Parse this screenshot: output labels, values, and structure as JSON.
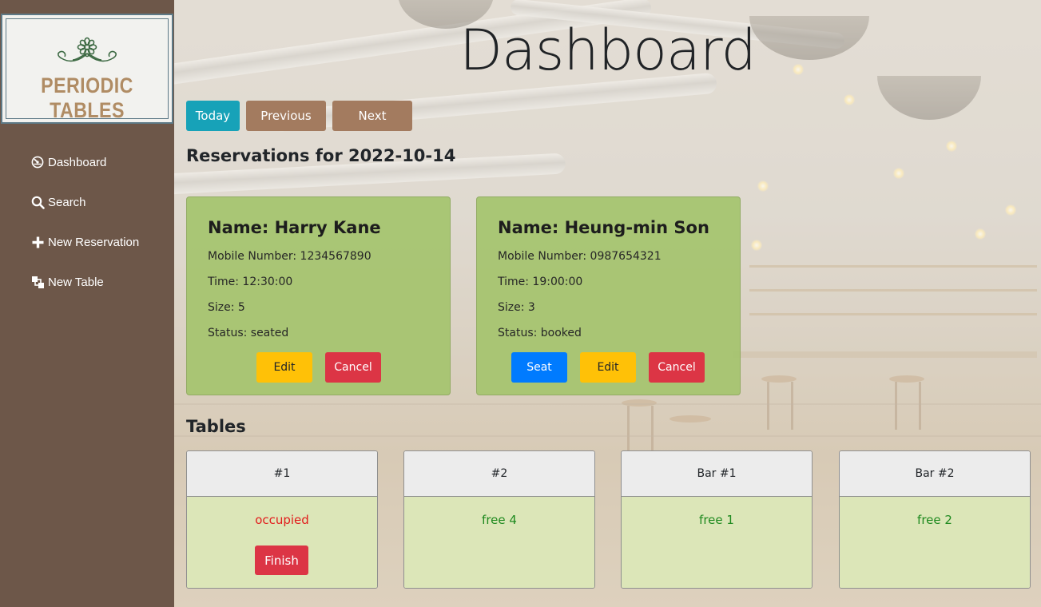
{
  "app": {
    "name": "PERIODIC TABLES"
  },
  "sidebar": {
    "items": [
      {
        "label": "Dashboard",
        "icon": "dashboard-icon"
      },
      {
        "label": "Search",
        "icon": "search-icon"
      },
      {
        "label": "New Reservation",
        "icon": "plus-icon"
      },
      {
        "label": "New Table",
        "icon": "table-icon"
      }
    ]
  },
  "header": {
    "title": "Dashboard"
  },
  "date_nav": {
    "today_label": "Today",
    "previous_label": "Previous",
    "next_label": "Next"
  },
  "reservations": {
    "heading": "Reservations for 2022-10-14",
    "cards": [
      {
        "name": "Name: Harry Kane",
        "mobile": "Mobile Number: 1234567890",
        "time": "Time: 12:30:00",
        "size": "Size: 5",
        "status": "Status: seated",
        "buttons": {
          "edit": "Edit",
          "cancel": "Cancel"
        }
      },
      {
        "name": "Name: Heung-min Son",
        "mobile": "Mobile Number: 0987654321",
        "time": "Time: 19:00:00",
        "size": "Size: 3",
        "status": "Status: booked",
        "buttons": {
          "seat": "Seat",
          "edit": "Edit",
          "cancel": "Cancel"
        }
      }
    ]
  },
  "tables": {
    "heading": "Tables",
    "cards": [
      {
        "name": "#1",
        "status": "occupied",
        "finish_label": "Finish"
      },
      {
        "name": "#2",
        "status": "free 4"
      },
      {
        "name": "Bar #1",
        "status": "free 1"
      },
      {
        "name": "Bar #2",
        "status": "free 2"
      }
    ]
  },
  "colors": {
    "sidebar": "#6d5749",
    "today_button": "#17a2b8",
    "nav_button": "#a37b5f",
    "card_green": "#a5c46e",
    "edit": "#ffc107",
    "cancel": "#dc3545",
    "seat": "#007bff",
    "free_text": "#1f8a1f",
    "occupied_text": "#e21b1b"
  }
}
